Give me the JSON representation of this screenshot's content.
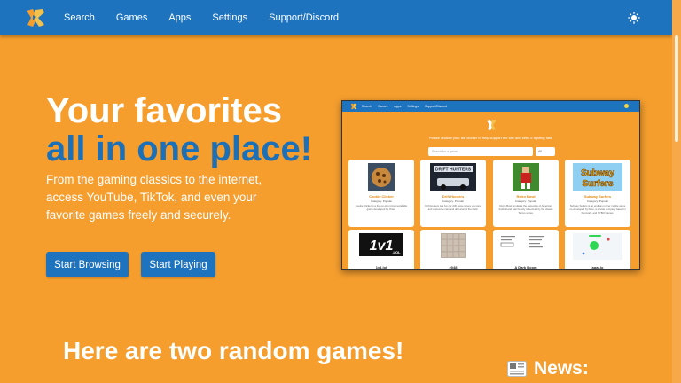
{
  "nav": {
    "links": [
      "Search",
      "Games",
      "Apps",
      "Settings",
      "Support/Discord"
    ]
  },
  "hero": {
    "title_line1": "Your favorites",
    "title_line2": "all in one place!",
    "description": "From the gaming classics to the internet, access YouTube, TikTok, and even your favorite games freely and securely.",
    "buttons": [
      "Start Browsing",
      "Start Playing"
    ]
  },
  "preview": {
    "nav_links": [
      "Search",
      "Games",
      "Apps",
      "Settings",
      "Support/Discord"
    ],
    "support_text": "Please disable your ad blocker to help support the site and keep it fighting fast!",
    "search_placeholder": "Search for a game...",
    "filter_value": "All",
    "games": [
      {
        "name": "Cookie Clicker",
        "category": "Category: Popular",
        "description": "Cookie Clicker is a free-to-play incremental idle game developed by Orteil."
      },
      {
        "name": "Drift Hunters",
        "category": "Category: Popular",
        "description": "Drift Hunters is a fun car drift game where you tune and customize cars and drift around the track."
      },
      {
        "name": "Retro Bowl",
        "category": "Category: Popular",
        "description": "Retro Bowl emulates the gameplay of American football and was heavily influenced by the classic Tecmo series."
      },
      {
        "name": "Subway Surfers",
        "category": "Category: Popular",
        "description": "Subway Surfers is an endless runner mobile game co-developed by Kiloo, a private company based in Denmark, and SYBO Games."
      },
      {
        "name": "1v1.lol",
        "category": "",
        "description": ""
      },
      {
        "name": "2048",
        "category": "",
        "description": ""
      },
      {
        "name": "A Dark Room",
        "category": "",
        "description": ""
      },
      {
        "name": "agar.io",
        "category": "",
        "description": ""
      }
    ]
  },
  "random_games": {
    "title": "Here are two random games!"
  },
  "news": {
    "label": "News:"
  },
  "colors": {
    "background": "#f59e2e",
    "nav": "#1d73be",
    "accent_text": "#1c70b8"
  }
}
